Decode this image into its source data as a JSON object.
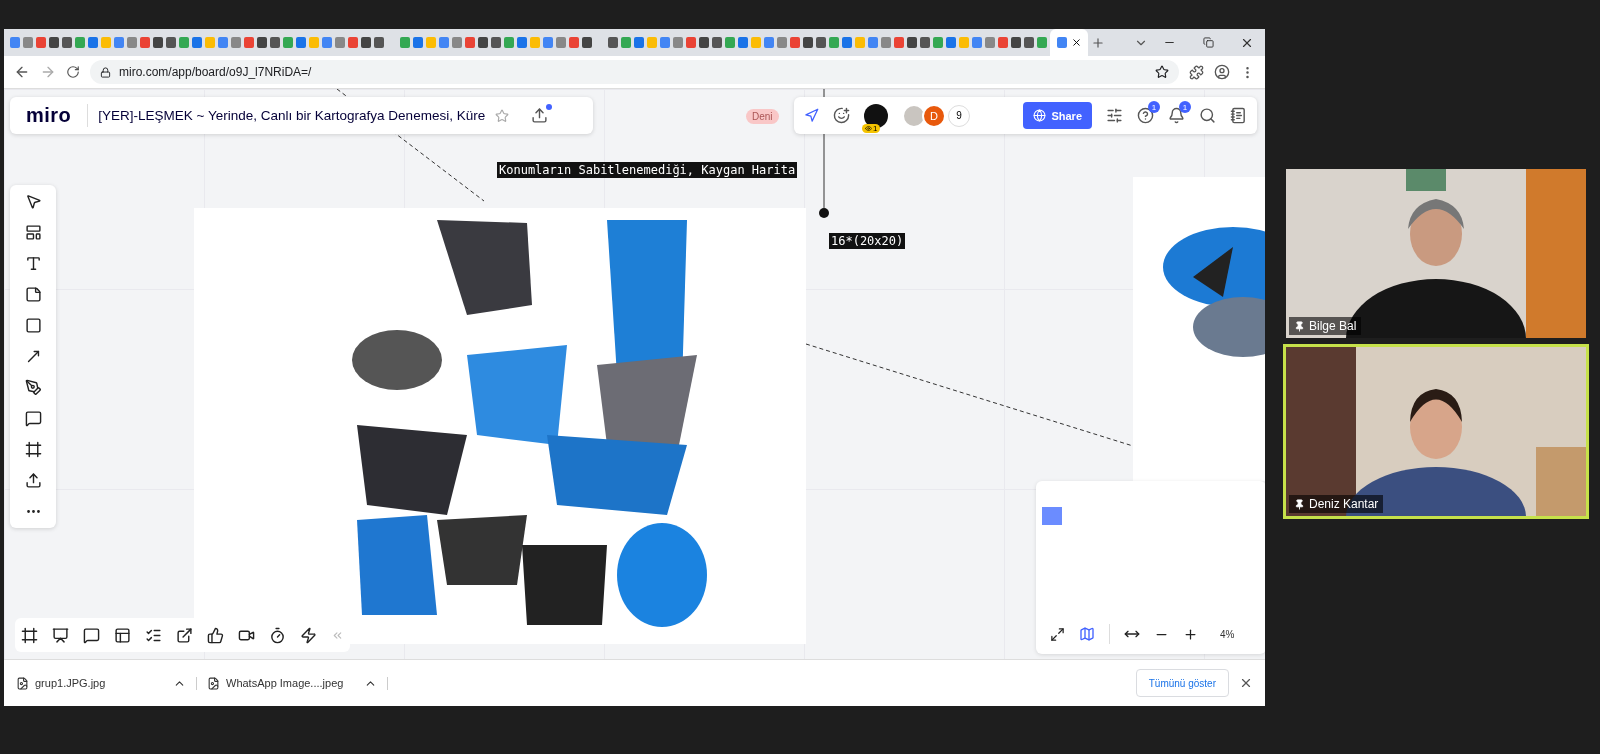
{
  "browser": {
    "address": "miro.com/app/board/o9J_l7NRiDA=/"
  },
  "board": {
    "logo": "miro",
    "title": "[YER]-LEŞMEK ~ Yerinde, Canlı bir Kartografya Denemesi, Küre",
    "cursor_tag": "Deni",
    "viewer_count": "1",
    "avatar_initial": "D",
    "participant_count": "9",
    "share_label": "Share",
    "help_badge": "1",
    "notification_badge": "1",
    "labels": [
      {
        "text": "Konumların Sabitlenemediği, Kaygan Harita"
      },
      {
        "text": "16*(20x20)"
      }
    ],
    "zoom_level": "4%"
  },
  "downloads": {
    "items": [
      "grup1.JPG.jpg",
      "WhatsApp Image....jpeg"
    ],
    "show_all": "Tümünü göster"
  },
  "participants": [
    {
      "name": "Bilge Bal",
      "speaking": false
    },
    {
      "name": "Deniz Kantar",
      "speaking": true
    }
  ]
}
